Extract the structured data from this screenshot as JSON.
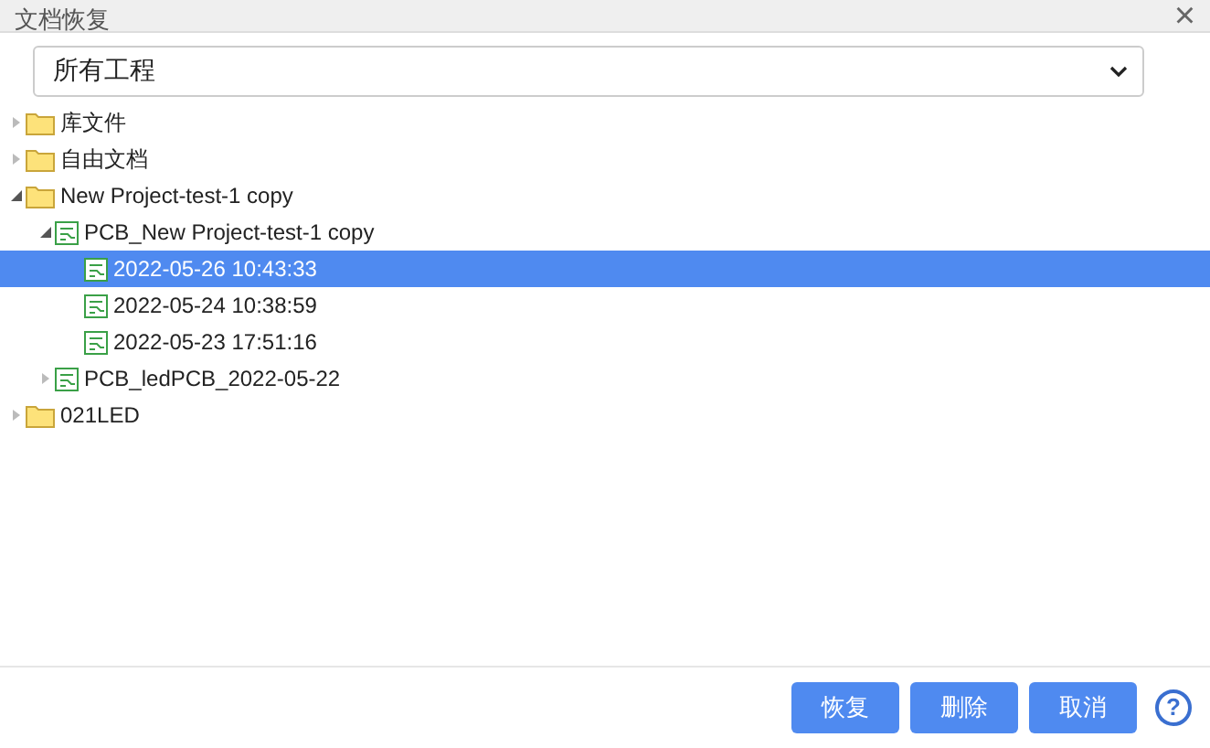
{
  "window": {
    "title": "文档恢复",
    "close": "×"
  },
  "filter": {
    "value": "所有工程"
  },
  "tree": [
    {
      "label": "库文件",
      "kind": "folder",
      "expanded": false,
      "selected": false
    },
    {
      "label": "自由文档",
      "kind": "folder",
      "expanded": false,
      "selected": false
    },
    {
      "label": "New Project-test-1 copy",
      "kind": "folder",
      "expanded": true,
      "selected": false,
      "children": [
        {
          "label": "PCB_New Project-test-1 copy",
          "kind": "file",
          "expanded": true,
          "selected": false,
          "children": [
            {
              "label": "2022-05-26 10:43:33",
              "kind": "file",
              "selected": true
            },
            {
              "label": "2022-05-24 10:38:59",
              "kind": "file",
              "selected": false
            },
            {
              "label": "2022-05-23 17:51:16",
              "kind": "file",
              "selected": false
            }
          ]
        },
        {
          "label": "PCB_ledPCB_2022-05-22",
          "kind": "file",
          "expanded": false,
          "selected": false
        }
      ]
    },
    {
      "label": "021LED",
      "kind": "folder",
      "expanded": false,
      "selected": false
    }
  ],
  "buttons": [
    "恢复",
    "删除",
    "取消"
  ],
  "help": "?"
}
